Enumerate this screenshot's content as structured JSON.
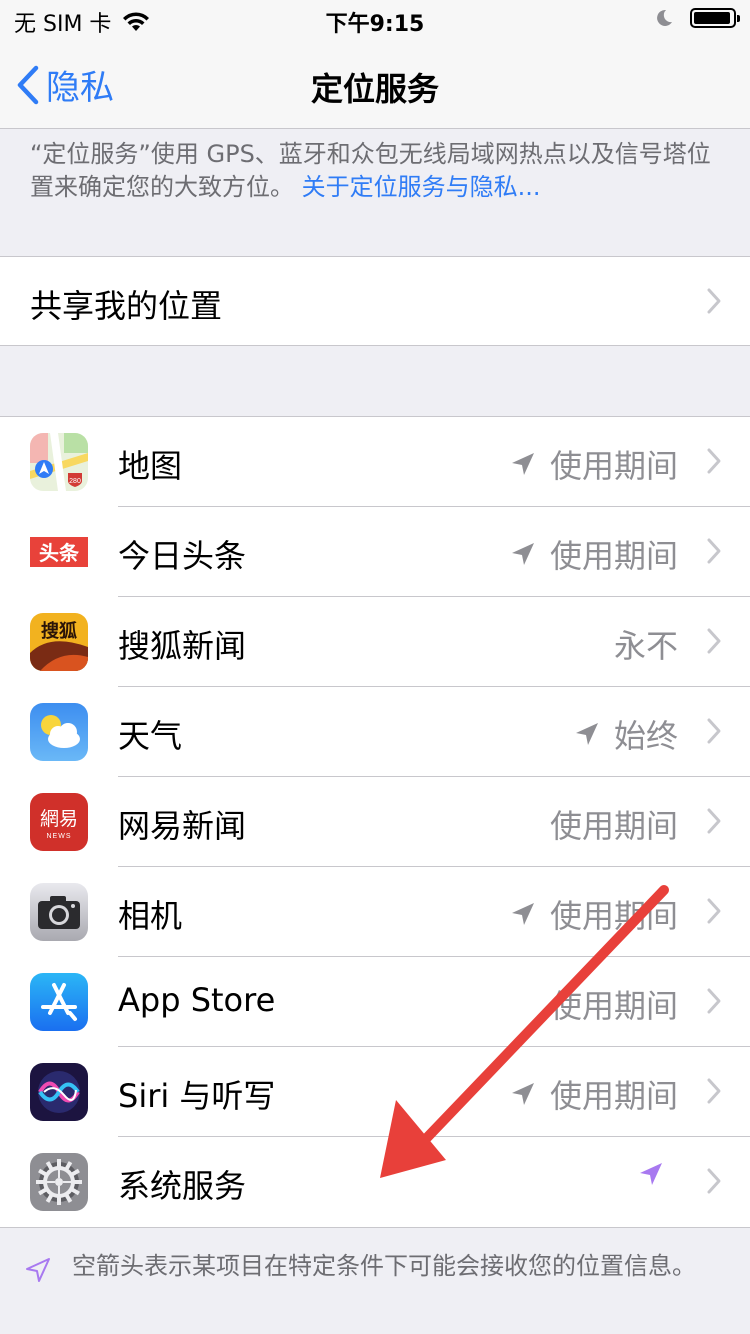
{
  "status_bar": {
    "carrier": "无 SIM 卡",
    "time": "下午9:15",
    "battery_level": 0.95
  },
  "nav": {
    "back_label": "隐私",
    "title": "定位服务"
  },
  "description": {
    "text": "“定位服务”使用 GPS、蓝牙和众包无线局域网热点以及信号塔位置来确定您的大致方位。",
    "link": "关于定位服务与隐私..."
  },
  "share": {
    "label": "共享我的位置"
  },
  "apps": [
    {
      "name": "地图",
      "value": "使用期间",
      "arrow": "gray",
      "icon": "maps-icon"
    },
    {
      "name": "今日头条",
      "value": "使用期间",
      "arrow": "gray",
      "icon": "toutiao-icon",
      "icon_text": "头条"
    },
    {
      "name": "搜狐新闻",
      "value": "永不",
      "arrow": "none",
      "icon": "sohu-news-icon",
      "icon_text": "搜狐"
    },
    {
      "name": "天气",
      "value": "始终",
      "arrow": "gray",
      "icon": "weather-icon"
    },
    {
      "name": "网易新闻",
      "value": "使用期间",
      "arrow": "none",
      "icon": "netease-news-icon",
      "icon_text": "網易",
      "icon_subtext": "NEWS"
    },
    {
      "name": "相机",
      "value": "使用期间",
      "arrow": "gray",
      "icon": "camera-icon"
    },
    {
      "name": "App Store",
      "value": "使用期间",
      "arrow": "none",
      "icon": "app-store-icon"
    },
    {
      "name": "Siri 与听写",
      "value": "使用期间",
      "arrow": "gray",
      "icon": "siri-icon"
    },
    {
      "name": "系统服务",
      "value": "",
      "arrow": "purple",
      "icon": "settings-gear-icon"
    }
  ],
  "footnote": {
    "text": "空箭头表示某项目在特定条件下可能会接收您的位置信息。"
  },
  "colors": {
    "link": "#2f7cf6",
    "arrow_gray": "#8e8e93",
    "arrow_purple": "#a879f0",
    "annotation_red": "#e8403a"
  }
}
